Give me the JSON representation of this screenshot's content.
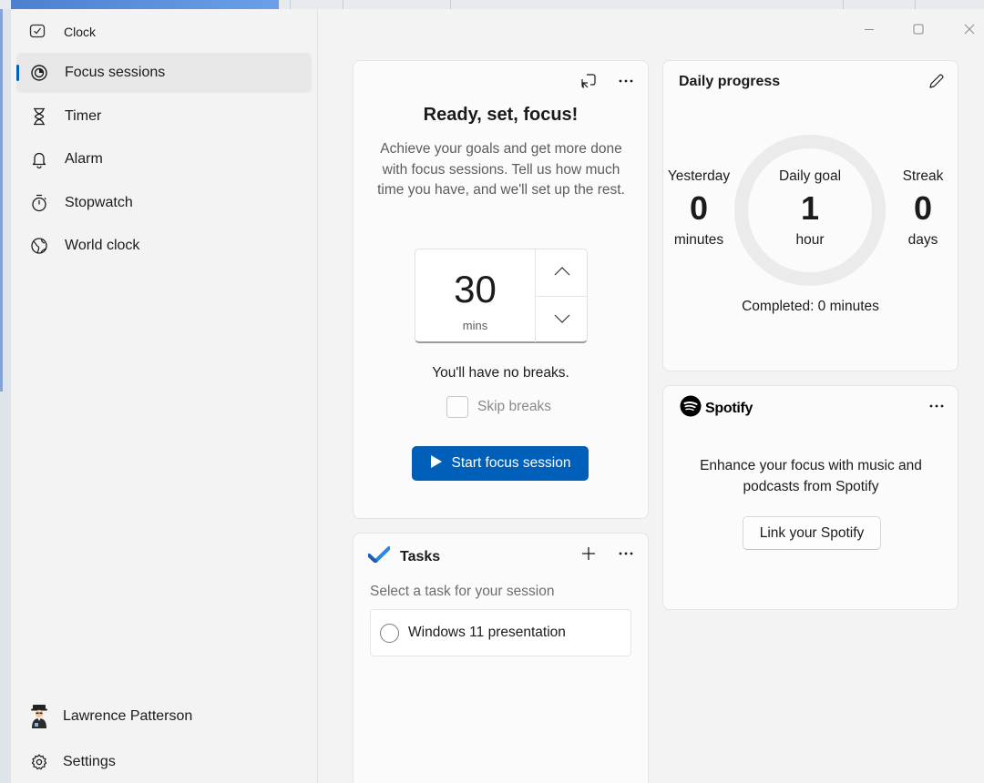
{
  "app": {
    "title": "Clock",
    "icon": "clock-app-icon"
  },
  "sidebar": {
    "items": [
      {
        "label": "Focus sessions",
        "icon": "focus-icon",
        "active": true
      },
      {
        "label": "Timer",
        "icon": "hourglass-icon",
        "active": false
      },
      {
        "label": "Alarm",
        "icon": "bell-icon",
        "active": false
      },
      {
        "label": "Stopwatch",
        "icon": "stopwatch-icon",
        "active": false
      },
      {
        "label": "World clock",
        "icon": "globe-icon",
        "active": false
      }
    ],
    "account": {
      "name": "Lawrence Patterson",
      "icon": "user-avatar"
    },
    "settings": {
      "label": "Settings",
      "icon": "gear-icon"
    }
  },
  "window_controls": [
    "minimize-icon",
    "maximize-icon",
    "close-icon"
  ],
  "focus_card": {
    "title": "Ready, set, focus!",
    "description": "Achieve your goals and get more done with focus sessions. Tell us how much time you have, and we'll set up the rest.",
    "duration_value": "30",
    "duration_unit": "mins",
    "breaks_note": "You'll have no breaks.",
    "skip_breaks_label": "Skip breaks",
    "skip_breaks_checked": false,
    "start_button_label": "Start focus session"
  },
  "tasks_card": {
    "title": "Tasks",
    "subtitle": "Select a task for your session",
    "items": [
      {
        "label": "Windows 11 presentation",
        "done": false
      }
    ]
  },
  "progress_card": {
    "title": "Daily progress",
    "yesterday": {
      "label": "Yesterday",
      "value": "0",
      "unit": "minutes"
    },
    "daily_goal": {
      "label": "Daily goal",
      "value": "1",
      "unit": "hour"
    },
    "streak": {
      "label": "Streak",
      "value": "0",
      "unit": "days"
    },
    "completed_text": "Completed: 0 minutes"
  },
  "spotify_card": {
    "brand": "Spotify",
    "text": "Enhance your focus with music and podcasts from Spotify",
    "link_button_label": "Link your Spotify"
  },
  "colors": {
    "accent": "#005fb8",
    "background": "#f3f3f3",
    "card": "#fbfbfb"
  }
}
